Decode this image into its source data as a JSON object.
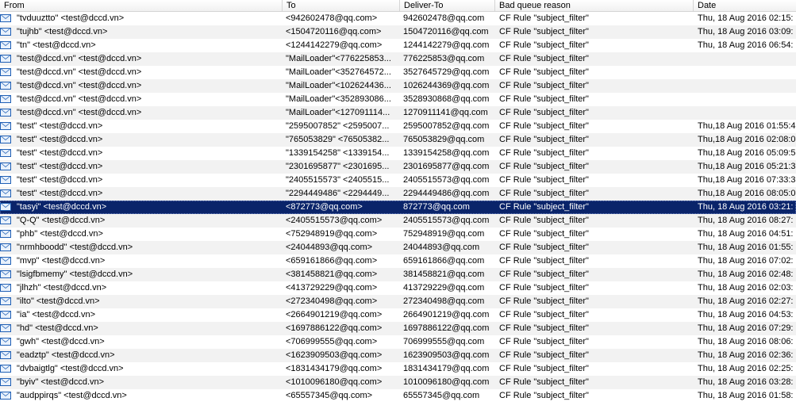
{
  "columns": {
    "from": "From",
    "to": "To",
    "deliver_to": "Deliver-To",
    "reason": "Bad queue reason",
    "date": "Date"
  },
  "selected_index": 15,
  "rows": [
    {
      "from": "\"tvduuztto\" <test@dccd.vn>",
      "to": "<942602478@qq.com>",
      "deliver_to": "942602478@qq.com",
      "reason": "CF Rule \"subject_filter\"",
      "date": "Thu, 18 Aug 2016 02:15:"
    },
    {
      "from": "\"tujhb\" <test@dccd.vn>",
      "to": "<1504720116@qq.com>",
      "deliver_to": "1504720116@qq.com",
      "reason": "CF Rule \"subject_filter\"",
      "date": "Thu, 18 Aug 2016 03:09:"
    },
    {
      "from": "\"tn\" <test@dccd.vn>",
      "to": "<1244142279@qq.com>",
      "deliver_to": "1244142279@qq.com",
      "reason": "CF Rule \"subject_filter\"",
      "date": "Thu, 18 Aug 2016 06:54:"
    },
    {
      "from": "\"test@dccd.vn\" <test@dccd.vn>",
      "to": "\"MailLoader\"<776225853...",
      "deliver_to": "776225853@qq.com",
      "reason": "CF Rule \"subject_filter\"",
      "date": ""
    },
    {
      "from": "\"test@dccd.vn\" <test@dccd.vn>",
      "to": "\"MailLoader\"<352764572...",
      "deliver_to": "3527645729@qq.com",
      "reason": "CF Rule \"subject_filter\"",
      "date": ""
    },
    {
      "from": "\"test@dccd.vn\" <test@dccd.vn>",
      "to": "\"MailLoader\"<102624436...",
      "deliver_to": "1026244369@qq.com",
      "reason": "CF Rule \"subject_filter\"",
      "date": ""
    },
    {
      "from": "\"test@dccd.vn\" <test@dccd.vn>",
      "to": "\"MailLoader\"<352893086...",
      "deliver_to": "3528930868@qq.com",
      "reason": "CF Rule \"subject_filter\"",
      "date": ""
    },
    {
      "from": "\"test@dccd.vn\" <test@dccd.vn>",
      "to": "\"MailLoader\"<127091114...",
      "deliver_to": "1270911141@qq.com",
      "reason": "CF Rule \"subject_filter\"",
      "date": ""
    },
    {
      "from": "\"test\" <test@dccd.vn>",
      "to": "\"2595007852\" <2595007...",
      "deliver_to": "2595007852@qq.com",
      "reason": "CF Rule \"subject_filter\"",
      "date": "Thu,18 Aug 2016 01:55:4"
    },
    {
      "from": "\"test\" <test@dccd.vn>",
      "to": "\"765053829\" <76505382...",
      "deliver_to": "765053829@qq.com",
      "reason": "CF Rule \"subject_filter\"",
      "date": "Thu,18 Aug 2016 02:08:0"
    },
    {
      "from": "\"test\" <test@dccd.vn>",
      "to": "\"1339154258\" <1339154...",
      "deliver_to": "1339154258@qq.com",
      "reason": "CF Rule \"subject_filter\"",
      "date": "Thu,18 Aug 2016 05:09:5"
    },
    {
      "from": "\"test\" <test@dccd.vn>",
      "to": "\"2301695877\" <2301695...",
      "deliver_to": "2301695877@qq.com",
      "reason": "CF Rule \"subject_filter\"",
      "date": "Thu,18 Aug 2016 05:21:3"
    },
    {
      "from": "\"test\" <test@dccd.vn>",
      "to": "\"2405515573\" <2405515...",
      "deliver_to": "2405515573@qq.com",
      "reason": "CF Rule \"subject_filter\"",
      "date": "Thu,18 Aug 2016 07:33:3"
    },
    {
      "from": "\"test\" <test@dccd.vn>",
      "to": "\"2294449486\" <2294449...",
      "deliver_to": "2294449486@qq.com",
      "reason": "CF Rule \"subject_filter\"",
      "date": "Thu,18 Aug 2016 08:05:0"
    },
    {
      "from": "\"tasyi\" <test@dccd.vn>",
      "to": "<872773@qq.com>",
      "deliver_to": "872773@qq.com",
      "reason": "CF Rule \"subject_filter\"",
      "date": "Thu, 18 Aug 2016 03:21:"
    },
    {
      "from": "\"Q-Q\" <test@dccd.vn>",
      "to": "<2405515573@qq.com>",
      "deliver_to": "2405515573@qq.com",
      "reason": "CF Rule \"subject_filter\"",
      "date": "Thu, 18 Aug 2016 08:27:"
    },
    {
      "from": "\"phb\" <test@dccd.vn>",
      "to": "<752948919@qq.com>",
      "deliver_to": "752948919@qq.com",
      "reason": "CF Rule \"subject_filter\"",
      "date": "Thu, 18 Aug 2016 04:51:"
    },
    {
      "from": "\"nrmhboodd\" <test@dccd.vn>",
      "to": "<24044893@qq.com>",
      "deliver_to": "24044893@qq.com",
      "reason": "CF Rule \"subject_filter\"",
      "date": "Thu, 18 Aug 2016 01:55:"
    },
    {
      "from": "\"mvp\" <test@dccd.vn>",
      "to": "<659161866@qq.com>",
      "deliver_to": "659161866@qq.com",
      "reason": "CF Rule \"subject_filter\"",
      "date": "Thu, 18 Aug 2016 07:02:"
    },
    {
      "from": "\"lsigfbmemy\" <test@dccd.vn>",
      "to": "<381458821@qq.com>",
      "deliver_to": "381458821@qq.com",
      "reason": "CF Rule \"subject_filter\"",
      "date": "Thu, 18 Aug 2016 02:48:"
    },
    {
      "from": "\"jlhzh\" <test@dccd.vn>",
      "to": "<413729229@qq.com>",
      "deliver_to": "413729229@qq.com",
      "reason": "CF Rule \"subject_filter\"",
      "date": "Thu, 18 Aug 2016 02:03:"
    },
    {
      "from": "\"ilto\" <test@dccd.vn>",
      "to": "<272340498@qq.com>",
      "deliver_to": "272340498@qq.com",
      "reason": "CF Rule \"subject_filter\"",
      "date": "Thu, 18 Aug 2016 02:27:"
    },
    {
      "from": "\"ia\" <test@dccd.vn>",
      "to": "<2664901219@qq.com>",
      "deliver_to": "2664901219@qq.com",
      "reason": "CF Rule \"subject_filter\"",
      "date": "Thu, 18 Aug 2016 04:53:"
    },
    {
      "from": "\"hd\" <test@dccd.vn>",
      "to": "<1697886122@qq.com>",
      "deliver_to": "1697886122@qq.com",
      "reason": "CF Rule \"subject_filter\"",
      "date": "Thu, 18 Aug 2016 07:29:"
    },
    {
      "from": "\"gwh\" <test@dccd.vn>",
      "to": "<706999555@qq.com>",
      "deliver_to": "706999555@qq.com",
      "reason": "CF Rule \"subject_filter\"",
      "date": "Thu, 18 Aug 2016 08:06:"
    },
    {
      "from": "\"eadztp\" <test@dccd.vn>",
      "to": "<1623909503@qq.com>",
      "deliver_to": "1623909503@qq.com",
      "reason": "CF Rule \"subject_filter\"",
      "date": "Thu, 18 Aug 2016 02:36:"
    },
    {
      "from": "\"dvbaigtlg\" <test@dccd.vn>",
      "to": "<1831434179@qq.com>",
      "deliver_to": "1831434179@qq.com",
      "reason": "CF Rule \"subject_filter\"",
      "date": "Thu, 18 Aug 2016 02:25:"
    },
    {
      "from": "\"byiv\" <test@dccd.vn>",
      "to": "<1010096180@qq.com>",
      "deliver_to": "1010096180@qq.com",
      "reason": "CF Rule \"subject_filter\"",
      "date": "Thu, 18 Aug 2016 03:28:"
    },
    {
      "from": "\"audppirqs\" <test@dccd.vn>",
      "to": "<65557345@qq.com>",
      "deliver_to": "65557345@qq.com",
      "reason": "CF Rule \"subject_filter\"",
      "date": "Thu, 18 Aug 2016 01:58:"
    }
  ]
}
